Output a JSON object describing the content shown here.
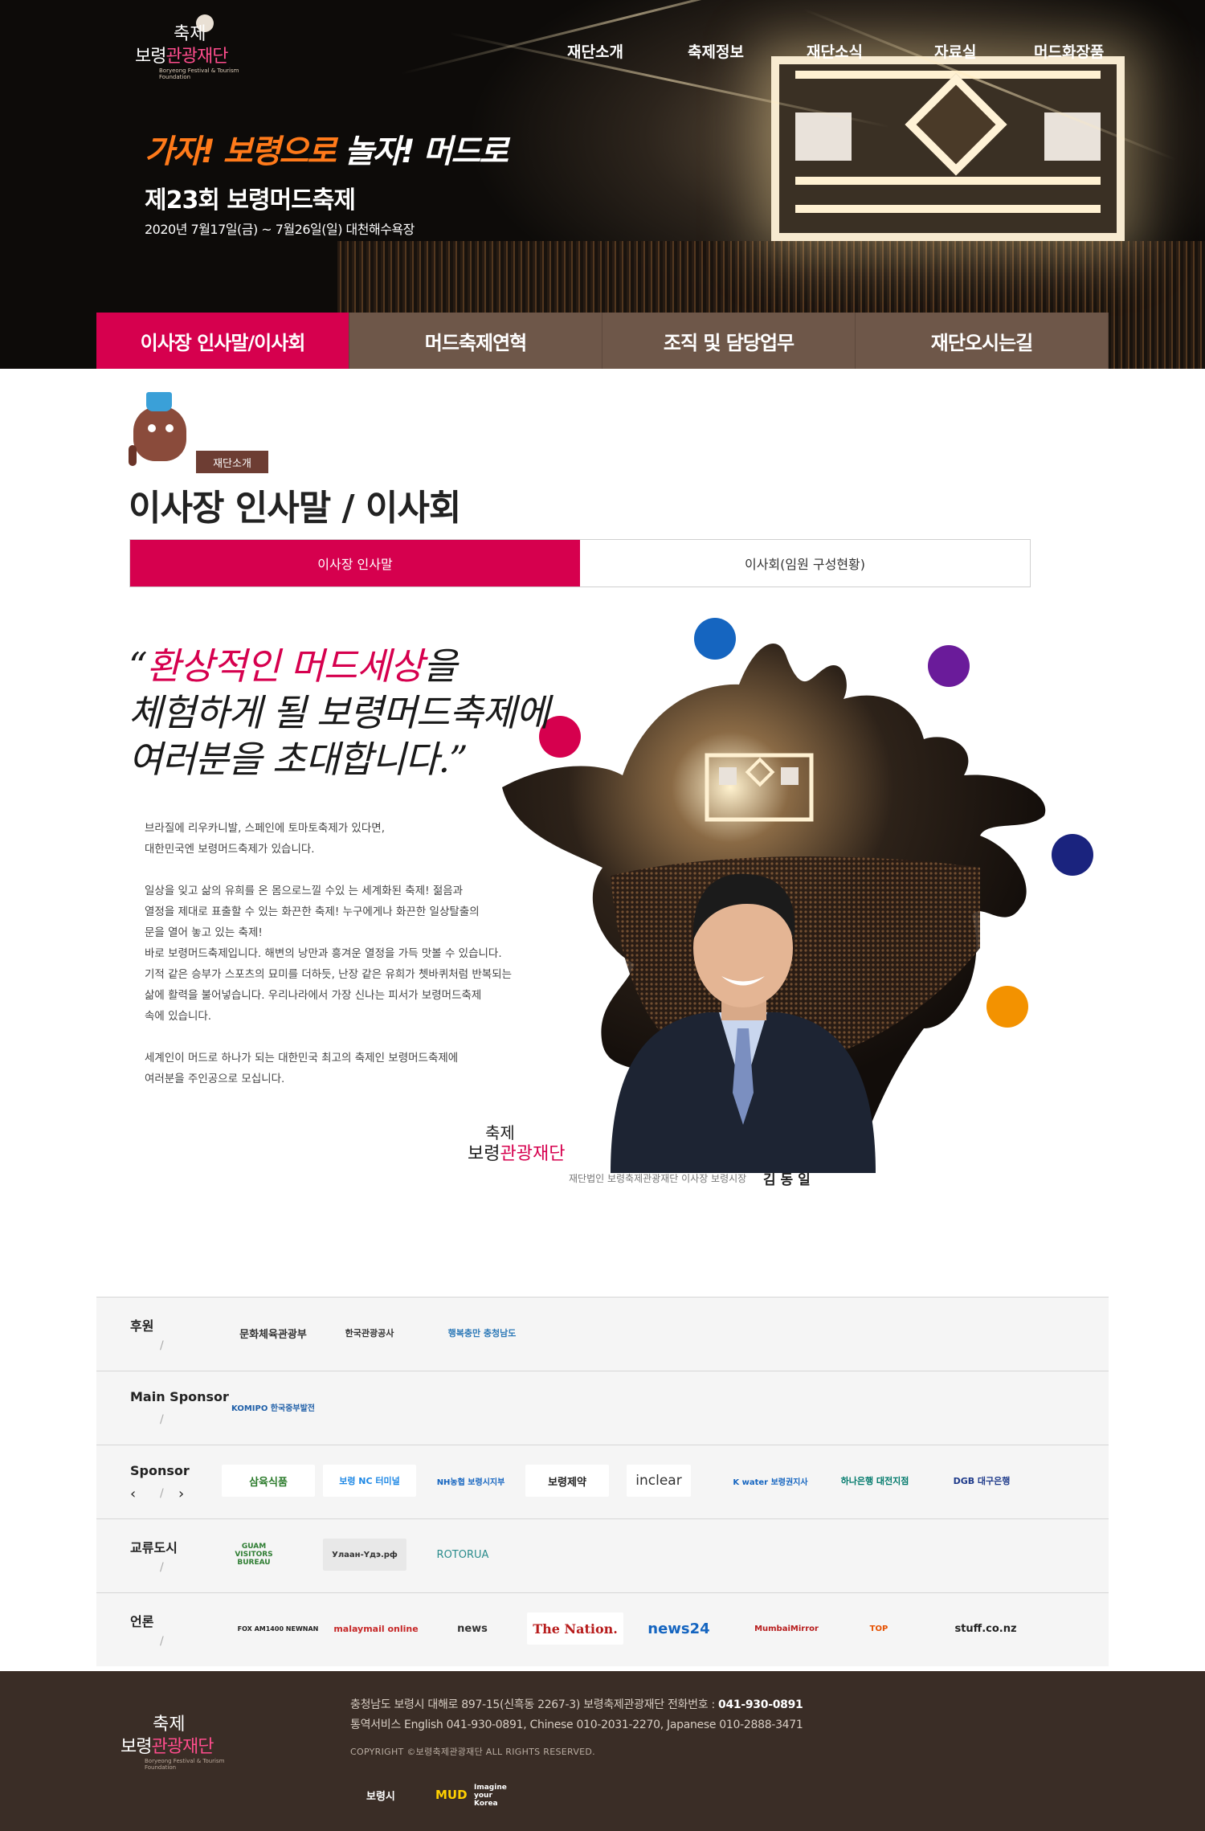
{
  "header": {
    "logo": {
      "line1": "축제",
      "line2a": "보령",
      "line2b": "관광재단",
      "tagline": "Boryeong Festival & Tourism Foundation"
    },
    "nav": [
      "재단소개",
      "축제정보",
      "재단소식",
      "자료실",
      "머드화장품"
    ],
    "slogan_part1": "가자! 보령으로",
    "slogan_part2": "놀자! 머드로",
    "event_title": "제23회 보령머드축제",
    "event_date": "2020년 7월17일(금) ~ 7월26일(일) 대천해수욕장"
  },
  "subnav": [
    {
      "label": "이사장 인사말/이사회",
      "active": true
    },
    {
      "label": "머드축제연혁",
      "active": false
    },
    {
      "label": "조직 및 담당업무",
      "active": false
    },
    {
      "label": "재단오시는길",
      "active": false
    }
  ],
  "page": {
    "category": "재단소개",
    "title": "이사장 인사말 / 이사회",
    "tabs": [
      {
        "label": "이사장 인사말",
        "active": true
      },
      {
        "label": "이사회(임원 구성현황)",
        "active": false
      }
    ]
  },
  "greeting": {
    "quote_open": "“",
    "quote_hl": "환상적인 머드세상",
    "quote_l1rest": "을",
    "quote_l2": "체험하게 될 보령머드축제에",
    "quote_l3": "여러분을 초대합니다.”",
    "paragraphs": [
      "브라질에 리우카니발, 스페인에 토마토축제가 있다면,\n대한민국엔 보령머드축제가 있습니다.",
      "일상을 잊고 삶의 유희를 온 몸으로느낄 수있 는 세계화된 축제! 젊음과\n열정을 제대로 표출할 수 있는 화끈한 축제! 누구에게나 화끈한 일상탈출의\n문을 열어 놓고 있는 축제!\n바로 보령머드축제입니다. 해변의 낭만과 흥겨운 열정을 가득 맛볼 수 있습니다.\n기적 같은 승부가 스포츠의 묘미를 더하듯, 난장 같은 유희가 쳇바퀴처럼 반복되는\n삶에 활력을 불어넣습니다. 우리나라에서 가장 신나는 피서가 보령머드축제\n속에 있습니다.",
      "세계인이 머드로 하나가 되는 대한민국 최고의 축제인 보령머드축제에\n여러분을 주인공으로 모십니다."
    ],
    "sig_role": "재단법인 보령축제관광재단 이사장 보령시장",
    "sig_name": "김 동 일",
    "dots": {
      "blue": "#1565c0",
      "purple": "#6a1b9a",
      "pink": "#d6004e",
      "navy": "#1a237e",
      "orange": "#f39200"
    }
  },
  "sponsors": [
    {
      "label": "후원",
      "has_arrows": false,
      "logos": [
        "문화체육관광부",
        "한국관광공사",
        "행복충만 충청남도"
      ]
    },
    {
      "label": "Main Sponsor",
      "has_arrows": false,
      "logos": [
        "KOMIPO 한국중부발전"
      ]
    },
    {
      "label": "Sponsor",
      "has_arrows": true,
      "logos": [
        "삼육식품",
        "보령 NC 터미널",
        "NH농협 보령시지부",
        "보령제약",
        "inclear",
        "K water 보령권지사",
        "하나은행 대전지점",
        "DGB 대구은행"
      ]
    },
    {
      "label": "교류도시",
      "has_arrows": false,
      "logos": [
        "GUAM VISITORS BUREAU",
        "Улаан-Үдэ.рф",
        "ROTORUA"
      ]
    },
    {
      "label": "언론",
      "has_arrows": false,
      "logos": [
        "FOX AM1400 NEWNAN",
        "malaymail online",
        "news",
        "The Nation.",
        "news24",
        "MumbaiMirror",
        "TOP",
        "stuff.co.nz"
      ]
    }
  ],
  "pager": {
    "prev": "‹",
    "sep": "/",
    "next": "›"
  },
  "footer": {
    "address_prefix": "충청남도 보령시 대해로 897-15(신흑동 2267-3) 보령축제관광재단 전화번호 : ",
    "phone": "041-930-0891",
    "interpret": "통역서비스 English 041-930-0891, Chinese 010-2031-2270, Japanese 010-2888-3471",
    "copyright": "COPYRIGHT ©보령축제관광재단 ALL RIGHTS RESERVED.",
    "links": [
      "보령시",
      "MUD",
      "Imagine your Korea"
    ]
  }
}
